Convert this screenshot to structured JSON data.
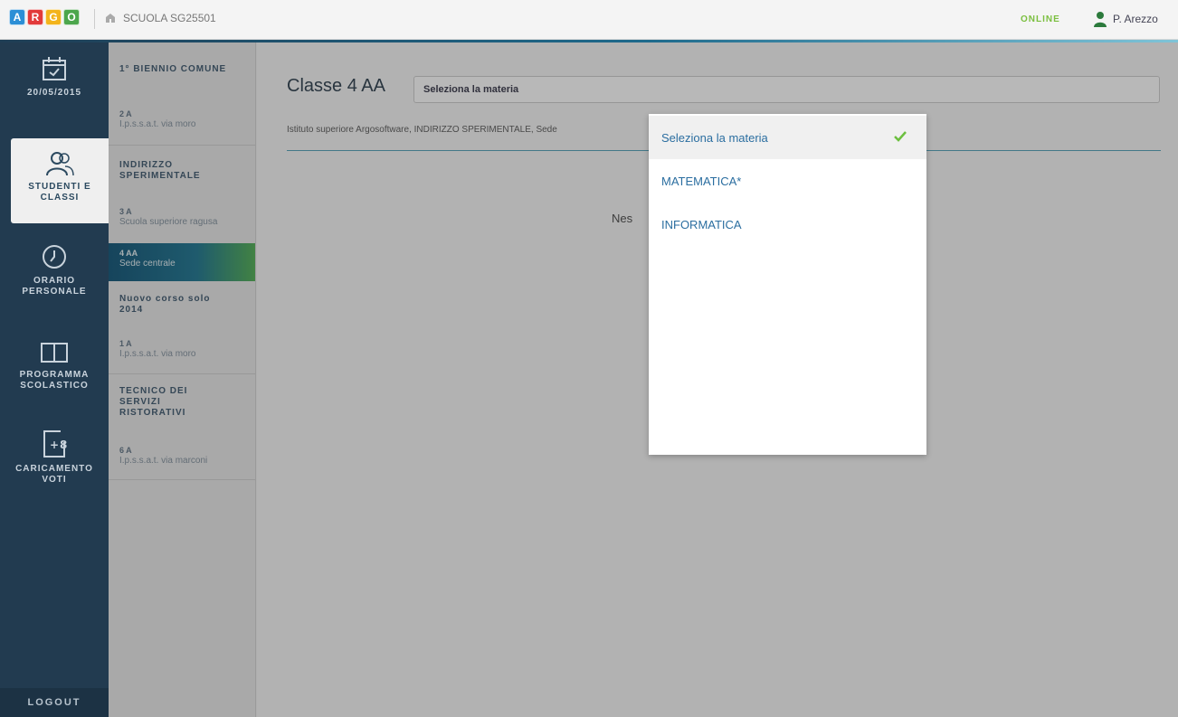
{
  "header": {
    "logo_letters": [
      "A",
      "R",
      "G",
      "O"
    ],
    "school": "SCUOLA SG25501",
    "status": "ONLINE",
    "user": "P. Arezzo"
  },
  "leftnav": {
    "date": "20/05/2015",
    "items": [
      {
        "label": "STUDENTI E CLASSI",
        "icon": "students-icon"
      },
      {
        "label": "ORARIO PERSONALE",
        "icon": "clock-icon"
      },
      {
        "label": "PROGRAMMA SCOLASTICO",
        "icon": "book-icon"
      },
      {
        "label": "CARICAMENTO VOTI",
        "icon": "grade-upload-icon"
      }
    ],
    "logout": "LOGOUT"
  },
  "classes": {
    "groups": [
      {
        "title": "1° BIENNIO COMUNE",
        "items": [
          {
            "name": "2 A",
            "location": "I.p.s.s.a.t. via moro"
          }
        ]
      },
      {
        "title": "INDIRIZZO SPERIMENTALE",
        "items": [
          {
            "name": "3 A",
            "location": "Scuola superiore ragusa"
          },
          {
            "name": "4 AA",
            "location": "Sede centrale"
          }
        ]
      },
      {
        "title": "Nuovo corso solo 2014",
        "items": [
          {
            "name": "1 A",
            "location": "I.p.s.s.a.t. via moro"
          }
        ]
      },
      {
        "title": "TECNICO DEI SERVIZI RISTORATIVI",
        "items": [
          {
            "name": "6 A",
            "location": "I.p.s.s.a.t. via marconi"
          }
        ]
      }
    ]
  },
  "main": {
    "class_title": "Classe 4 AA",
    "subject_placeholder": "Seleziona la materia",
    "institute": "Istituto superiore Argosoftware, INDIRIZZO SPERIMENTALE, Sede",
    "empty_message_partial": "Nes"
  },
  "dropdown": {
    "options": [
      "Seleziona la materia",
      "MATEMATICA*",
      "INFORMATICA"
    ],
    "selected_index": 0
  },
  "colors": {
    "nav_bg": "#223b50",
    "online": "#7bbf3f",
    "link": "#2b6ea0",
    "check": "#6cbf3f"
  }
}
